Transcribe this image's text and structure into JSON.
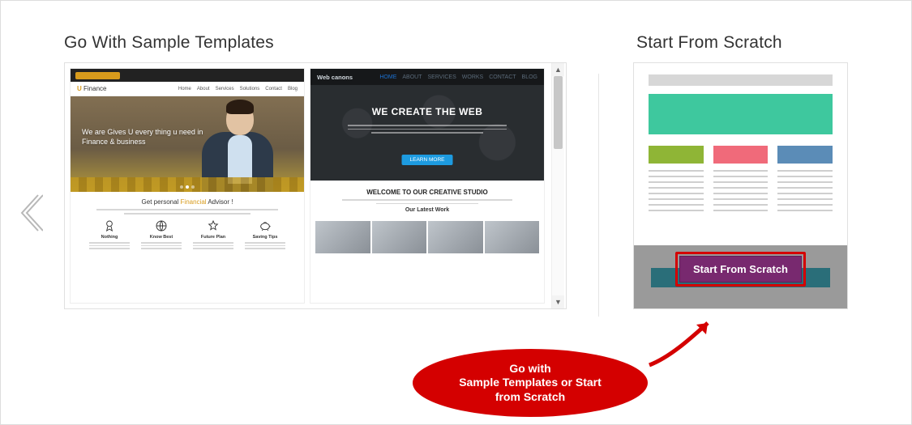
{
  "sections": {
    "templates_title": "Go With Sample Templates",
    "scratch_title": "Start From Scratch"
  },
  "template1": {
    "brand_prefix": "U",
    "brand_suffix": " Finance",
    "nav": [
      "Home",
      "About",
      "Services",
      "Solutions",
      "Contact",
      "Blog"
    ],
    "hero_line1": "We are Gives U every thing u need in",
    "hero_line2": "Finance & business",
    "mid_prefix": "Get personal ",
    "mid_highlight": "Financial",
    "mid_suffix": " Advisor !",
    "icons": [
      "Nothing",
      "Know Best",
      "Future Plan",
      "Saving Tips"
    ]
  },
  "template2": {
    "brand": "Web canons",
    "nav_home": "HOME",
    "nav": [
      "ABOUT",
      "SERVICES",
      "WORKS",
      "CONTACT",
      "BLOG"
    ],
    "hero_title": "WE CREATE THE WEB",
    "cta": "LEARN MORE",
    "section_title": "WELCOME TO OUR CREATIVE STUDIO",
    "sub_title": "Our Latest Work"
  },
  "scratch": {
    "button": "Start From Scratch"
  },
  "callout": {
    "line1": "Go with",
    "line2": "Sample Templates or Start",
    "line3": "from Scratch"
  }
}
